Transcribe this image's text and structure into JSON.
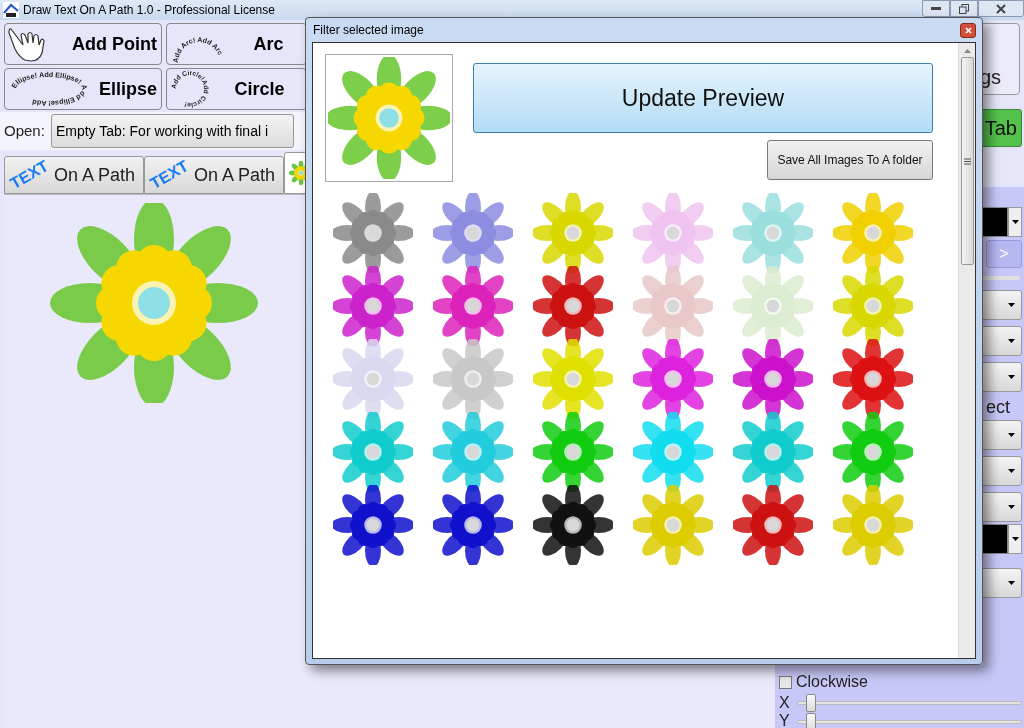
{
  "window": {
    "title": "Draw Text On A Path 1.0 - Professional License"
  },
  "toolbar": [
    {
      "kind": "hand",
      "label": "Add Point"
    },
    {
      "kind": "arc",
      "label": "Arc",
      "path_text": "Add Arc! Add Arc"
    },
    {
      "kind": "ellipse",
      "label": "Ellipse",
      "path_text": "Ellipse! Add Ellipse! Add Ellipse! Add"
    },
    {
      "kind": "circle",
      "label": "Circle",
      "path_text": "Add Circle!Add Circle!"
    }
  ],
  "open": {
    "label": "Open:",
    "value": "Empty Tab: For working with final i"
  },
  "tabs": [
    {
      "kind": "text",
      "icon_text": "TEXT",
      "label": "On A Path",
      "selected": false
    },
    {
      "kind": "text",
      "icon_text": "TEXT",
      "label": "On A Path",
      "selected": false
    },
    {
      "kind": "image",
      "selected": true
    }
  ],
  "right_panel": {
    "settings_label": "gs",
    "new_tab_label": "Tab",
    "next_label": ">",
    "section_label": "ect",
    "clockwise": {
      "label": "Clockwise",
      "checked": false
    },
    "sliders": [
      {
        "label": "X",
        "level": 0.04
      },
      {
        "label": "Y",
        "level": 0.04
      }
    ]
  },
  "dialog": {
    "title": "Filter selected image",
    "update_button": "Update Preview",
    "save_button": "Save All Images To A folder",
    "filters": [
      {
        "color": "#8a8a8a"
      },
      {
        "color": "#8c8ce0"
      },
      {
        "color": "#d8d800"
      },
      {
        "color": "#f0c4f0"
      },
      {
        "color": "#9adede"
      },
      {
        "color": "#f0d000"
      },
      {
        "color": "#cc22cc"
      },
      {
        "color": "#dd22bb"
      },
      {
        "color": "#cc1111"
      },
      {
        "color": "#e8c8c8"
      },
      {
        "color": "#dcecd0"
      },
      {
        "color": "#d8d800"
      },
      {
        "color": "#d8d8f0"
      },
      {
        "color": "#c8c8c8"
      },
      {
        "color": "#e0e000"
      },
      {
        "color": "#dd22dd"
      },
      {
        "color": "#cc11cc"
      },
      {
        "color": "#dd1111"
      },
      {
        "color": "#11cccc"
      },
      {
        "color": "#22ccdd"
      },
      {
        "color": "#11cc11"
      },
      {
        "color": "#11ddee"
      },
      {
        "color": "#11cccc"
      },
      {
        "color": "#11cc11"
      },
      {
        "color": "#1111cc"
      },
      {
        "color": "#1111cc"
      },
      {
        "color": "#111111"
      },
      {
        "color": "#ddcc00"
      },
      {
        "color": "#cc1111"
      },
      {
        "color": "#ddcc00"
      }
    ]
  }
}
